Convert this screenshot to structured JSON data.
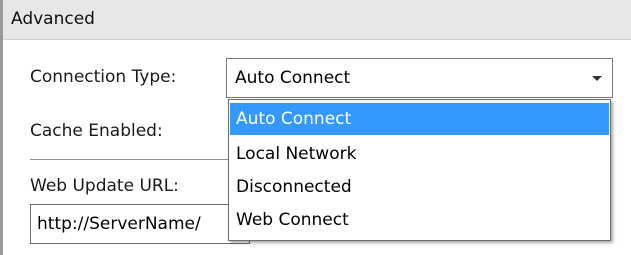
{
  "group": {
    "title": "Advanced"
  },
  "connection_type": {
    "label": "Connection Type:",
    "selected": "Auto Connect",
    "options": [
      "Auto Connect",
      "Local Network",
      "Disconnected",
      "Web Connect"
    ]
  },
  "cache": {
    "label": "Cache Enabled:"
  },
  "web_update": {
    "label": "Web Update URL:",
    "value": "http://ServerName/"
  },
  "colors": {
    "selection_highlight": "#3399ff",
    "header_background": "#e7e7e7"
  },
  "icons": {
    "combo_arrow": "chevron-down-icon"
  }
}
